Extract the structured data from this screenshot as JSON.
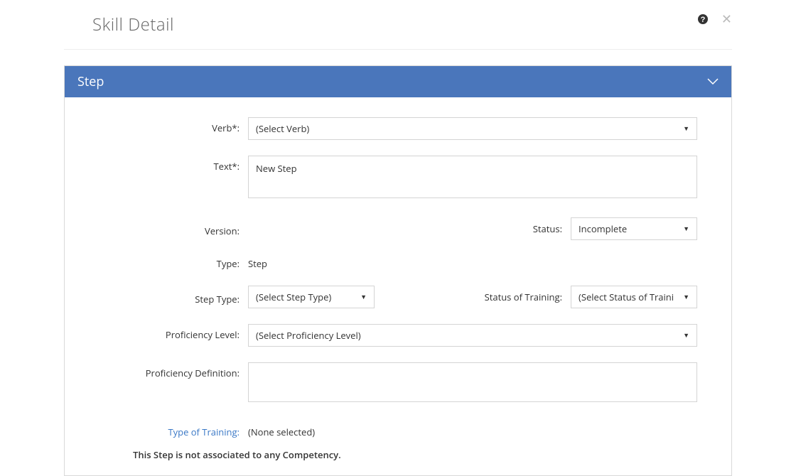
{
  "title": "Skill Detail",
  "panel": {
    "header": "Step"
  },
  "labels": {
    "verb": "Verb*:",
    "text": "Text*:",
    "version": "Version:",
    "status": "Status:",
    "type": "Type:",
    "stepType": "Step Type:",
    "statusTraining": "Status of Training:",
    "profLevel": "Proficiency Level:",
    "profDef": "Proficiency Definition:",
    "typeTraining": "Type of Training:"
  },
  "values": {
    "verb": "(Select Verb)",
    "text": "New Step",
    "version": "",
    "status": "Incomplete",
    "type": "Step",
    "stepType": "(Select Step Type)",
    "statusTraining": "(Select Status of Traini",
    "profLevel": "(Select Proficiency Level)",
    "profDef": "",
    "typeTraining": "(None selected)"
  },
  "note": "This Step is not associated to any Competency."
}
